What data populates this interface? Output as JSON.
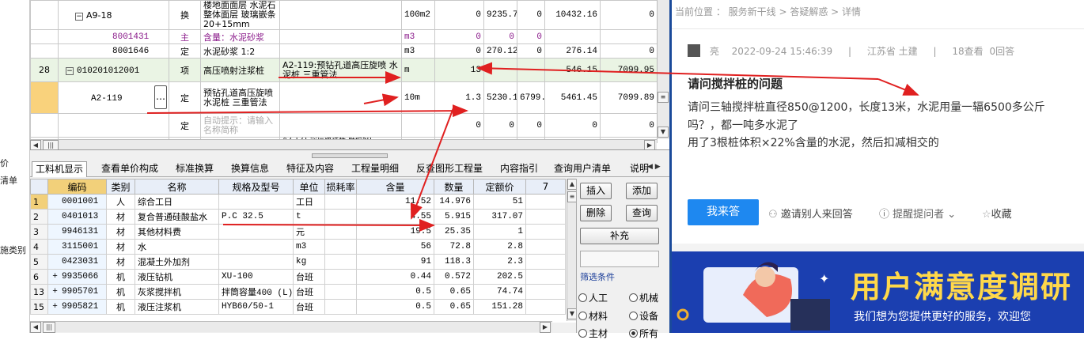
{
  "left_strip": {
    "items": [
      "价",
      "清单",
      "施类别"
    ]
  },
  "upper_grid": {
    "rows": [
      {
        "no": "",
        "code": "A9-18",
        "type": "换",
        "name": "楼地面面层 水泥石整体面层 玻璃嵌条 20+15mm",
        "spec": "",
        "unit": "100m2",
        "qty": "0",
        "price": "9235.75",
        "p2": "0",
        "total": "10432.16",
        "t2": "0"
      },
      {
        "no": "",
        "code": "8001431",
        "type": "主",
        "name": "含量：水泥砂浆",
        "spec": "",
        "unit": "m3",
        "qty": "0",
        "price": "0",
        "p2": "0",
        "total": "",
        "t2": ""
      },
      {
        "no": "",
        "code": "8001646",
        "type": "定",
        "name": "水泥砂浆 1:2",
        "spec": "",
        "unit": "m3",
        "qty": "0",
        "price": "270.12",
        "p2": "0",
        "total": "276.14",
        "t2": "0"
      },
      {
        "no": "28",
        "code": "010201012001",
        "type": "项",
        "name": "高压喷射注浆桩",
        "spec": "A2-119:预钻孔道高压旋喷 水泥桩 三重管法",
        "unit": "m",
        "qty": "13",
        "price": "",
        "p2": "",
        "total": "546.15",
        "t2": "7099.95"
      },
      {
        "no": "",
        "code": "A2-119",
        "type": "定",
        "name": "预钻孔道高压旋喷水泥桩 三重管法",
        "spec": "",
        "unit": "10m",
        "qty": "1.3",
        "price": "5230.12",
        "p2": "6799.16",
        "total": "5461.45",
        "t2": "7099.89"
      },
      {
        "no": "",
        "code": "",
        "type": "定",
        "name": "自动提示：请输入名称简称",
        "spec": "",
        "unit": "",
        "qty": "0",
        "price": "0",
        "p2": "0",
        "total": "0",
        "t2": "0"
      }
    ],
    "partial_row": "A2-121 深层搅拌桩 桩径50"
  },
  "tabs": [
    "工料机显示",
    "查看单价构成",
    "标准换算",
    "换算信息",
    "特征及内容",
    "工程量明细",
    "反查图形工程量",
    "内容指引",
    "查询用户清单",
    "说明"
  ],
  "lower_grid": {
    "headers": [
      "编码",
      "类别",
      "名称",
      "规格及型号",
      "单位",
      "损耗率",
      "含量",
      "数量",
      "定额价",
      "7"
    ],
    "rows": [
      {
        "rn": "1",
        "exp": "",
        "code": "0001001",
        "cat": "人",
        "name": "综合工日",
        "spec": "",
        "unit": "工日",
        "loss": "",
        "content": "11.52",
        "qty": "14.976",
        "price": "51"
      },
      {
        "rn": "2",
        "exp": "",
        "code": "0401013",
        "cat": "材",
        "name": "复合普通硅酸盐水",
        "spec": "P.C 32.5",
        "unit": "t",
        "loss": "",
        "content": "4.55",
        "qty": "5.915",
        "price": "317.07"
      },
      {
        "rn": "3",
        "exp": "",
        "code": "9946131",
        "cat": "材",
        "name": "其他材料费",
        "spec": "",
        "unit": "元",
        "loss": "",
        "content": "19.5",
        "qty": "25.35",
        "price": "1"
      },
      {
        "rn": "4",
        "exp": "",
        "code": "3115001",
        "cat": "材",
        "name": "水",
        "spec": "",
        "unit": "m3",
        "loss": "",
        "content": "56",
        "qty": "72.8",
        "price": "2.8"
      },
      {
        "rn": "5",
        "exp": "",
        "code": "0423031",
        "cat": "材",
        "name": "混凝土外加剂",
        "spec": "",
        "unit": "kg",
        "loss": "",
        "content": "91",
        "qty": "118.3",
        "price": "2.3"
      },
      {
        "rn": "6",
        "exp": "+",
        "code": "9935066",
        "cat": "机",
        "name": "液压钻机",
        "spec": "XU-100",
        "unit": "台班",
        "loss": "",
        "content": "0.44",
        "qty": "0.572",
        "price": "202.5"
      },
      {
        "rn": "13",
        "exp": "+",
        "code": "9905701",
        "cat": "机",
        "name": "灰浆搅拌机",
        "spec": "拌筒容量400 (L)",
        "unit": "台班",
        "loss": "",
        "content": "0.5",
        "qty": "0.65",
        "price": "74.74"
      },
      {
        "rn": "15",
        "exp": "+",
        "code": "9905821",
        "cat": "机",
        "name": "液压注浆机",
        "spec": "HYB60/50-1",
        "unit": "台班",
        "loss": "",
        "content": "0.5",
        "qty": "0.65",
        "price": "151.28"
      }
    ]
  },
  "side_buttons": {
    "insert": "插入",
    "add": "添加",
    "delete": "删除",
    "query": "查询",
    "supplement": "补充",
    "filter_label": "筛选条件",
    "opt_labor": "人工",
    "opt_machine": "机械",
    "opt_material": "材料",
    "opt_equip": "设备",
    "opt_main": "主材",
    "opt_all": "所有"
  },
  "qa": {
    "breadcrumb": "当前位置 ： 服务新干线 > 答疑解惑 > 详情",
    "author": "亮",
    "time": "2022-09-24 15:46:39",
    "region": "江苏省 土建",
    "views": "18查看",
    "answers": "0回答",
    "title": "请问搅拌桩的问题",
    "body1": "请问三轴搅拌桩直径850@1200，长度13米，水泥用量一辐6500多公斤",
    "body2": "吗？，都一吨多水泥了",
    "body3": "用了3根桩体积×22%含量的水泥，然后扣减相交的",
    "answer_btn": "我来答",
    "invite": "邀请别人来回答",
    "remind": "提醒提问者",
    "collect": "收藏"
  },
  "banner": {
    "title": "用户满意度调研",
    "sub": "我们想为您提供更好的服务，欢迎您"
  },
  "colors": {
    "arrow": "#e02020",
    "accent_blue": "#1e88f0",
    "banner_bg": "#1b3fb0",
    "banner_title": "#ffd84a",
    "selected": "#f2d07a"
  }
}
